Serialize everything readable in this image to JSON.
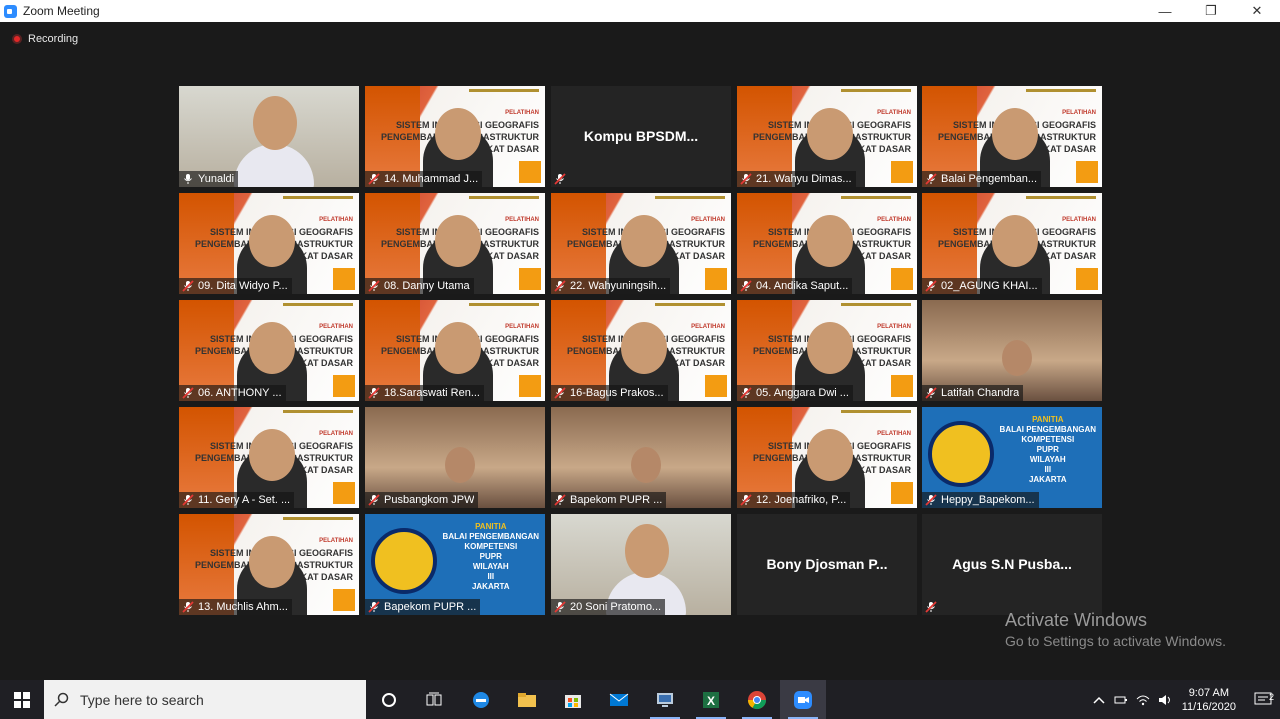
{
  "window": {
    "title": "Zoom Meeting",
    "minimize_glyph": "—",
    "restore_glyph": "❐",
    "close_glyph": "✕"
  },
  "recording": {
    "label": "Recording"
  },
  "slide_text": {
    "tag": "PESERTA",
    "tag2": "PELATIHAN",
    "line1": "SISTEM INFORMASI GEOGRAFIS UNTUK",
    "line2": "PENGEMBANGAN INFRASTRUKTUR WILAYAH",
    "line3": "TINGKAT DASAR"
  },
  "panitia_text": {
    "line1": "PANITIA",
    "line2": "BALAI PENGEMBANGAN",
    "line3": "KOMPETENSI",
    "line4": "PUPR",
    "line5": "WILAYAH",
    "line6": "III",
    "line7": "JAKARTA"
  },
  "participants": [
    {
      "name": "Yunaldi",
      "type": "video",
      "active": true,
      "muted": false
    },
    {
      "name": "14. Muhammad J...",
      "type": "slide",
      "muted": true
    },
    {
      "name": "Kompu BPSDM...",
      "type": "name",
      "muted": true
    },
    {
      "name": "21. Wahyu Dimas...",
      "type": "slide",
      "muted": true
    },
    {
      "name": "Balai Pengemban...",
      "type": "slide",
      "muted": true
    },
    {
      "name": "09. Dita Widyo P...",
      "type": "slide",
      "muted": true
    },
    {
      "name": "08. Danny Utama",
      "type": "slide",
      "muted": true
    },
    {
      "name": "22. Wahyuningsih...",
      "type": "slide",
      "muted": true
    },
    {
      "name": "04. Andika Saput...",
      "type": "slide",
      "muted": true
    },
    {
      "name": "02_AGUNG KHAI...",
      "type": "slide",
      "muted": true
    },
    {
      "name": "06. ANTHONY ...",
      "type": "slide",
      "muted": true
    },
    {
      "name": "18.Saraswati Ren...",
      "type": "slide",
      "muted": true
    },
    {
      "name": "16-Bagus Prakos...",
      "type": "slide",
      "muted": true
    },
    {
      "name": "05. Anggara Dwi ...",
      "type": "slide",
      "muted": true
    },
    {
      "name": "Latifah Chandra",
      "type": "room",
      "muted": true
    },
    {
      "name": "11. Gery A - Set. ...",
      "type": "slide",
      "muted": true
    },
    {
      "name": "Pusbangkom JPW",
      "type": "room",
      "muted": true
    },
    {
      "name": "Bapekom PUPR ...",
      "type": "room",
      "muted": true
    },
    {
      "name": "12. Joenafriko, P...",
      "type": "slide",
      "muted": true
    },
    {
      "name": "Heppy_Bapekom...",
      "type": "panitia",
      "muted": true
    },
    {
      "name": "13. Muchlis Ahm...",
      "type": "slide",
      "muted": true
    },
    {
      "name": "Bapekom PUPR ...",
      "type": "panitia",
      "muted": true
    },
    {
      "name": "20 Soni Pratomo...",
      "type": "video",
      "muted": true
    },
    {
      "name": "Bony Djosman P...",
      "type": "name",
      "muted": false
    },
    {
      "name": "Agus S.N Pusba...",
      "type": "name",
      "muted": true
    }
  ],
  "watermark": {
    "line1": "Activate Windows",
    "line2": "Go to Settings to activate Windows."
  },
  "taskbar": {
    "search_placeholder": "Type here to search",
    "time": "9:07 AM",
    "date": "11/16/2020",
    "notification_count": "2",
    "apps": [
      "cortana-icon",
      "task-view-icon",
      "edge-icon",
      "file-explorer-icon",
      "store-icon",
      "mail-icon",
      "remote-desktop-icon",
      "excel-icon",
      "chrome-icon",
      "zoom-icon"
    ]
  }
}
